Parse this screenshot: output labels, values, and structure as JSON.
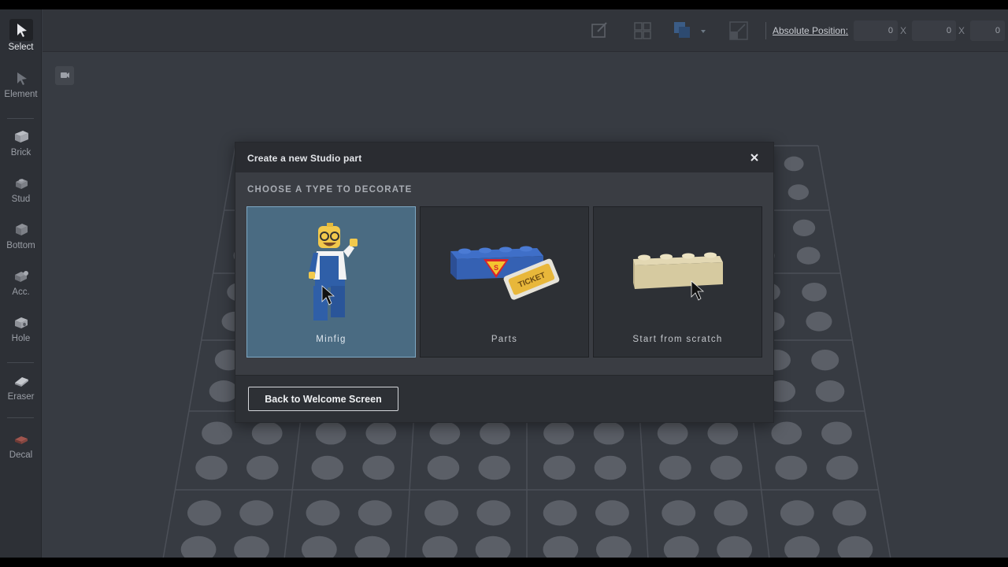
{
  "toolbar": {
    "items": [
      {
        "label": "Select",
        "icon": "arrow-select-icon",
        "active": true
      },
      {
        "label": "Element",
        "icon": "arrow-element-icon"
      },
      {
        "label": "Brick",
        "icon": "brick-icon"
      },
      {
        "label": "Stud",
        "icon": "stud-icon"
      },
      {
        "label": "Bottom",
        "icon": "bottom-icon"
      },
      {
        "label": "Acc.",
        "icon": "accessory-icon"
      },
      {
        "label": "Hole",
        "icon": "hole-icon"
      },
      {
        "label": "Eraser",
        "icon": "eraser-icon"
      },
      {
        "label": "Decal",
        "icon": "decal-icon"
      }
    ]
  },
  "header": {
    "absolute_position_label": "Absolute Position",
    "coords": [
      "0",
      "0",
      "0"
    ],
    "axis_x": "X"
  },
  "dialog": {
    "title": "Create a new Studio part",
    "subtitle": "CHOOSE A TYPE TO DECORATE",
    "options": [
      {
        "label": "Minfig",
        "selected": true
      },
      {
        "label": "Parts",
        "selected": false
      },
      {
        "label": "Start from scratch",
        "selected": false
      }
    ],
    "parts_ticket_text": "TICKET",
    "back_button": "Back to Welcome Screen"
  },
  "colors": {
    "accent_selected": "#4a6b82",
    "background": "#373b42",
    "dialog": "#3a3d43"
  }
}
